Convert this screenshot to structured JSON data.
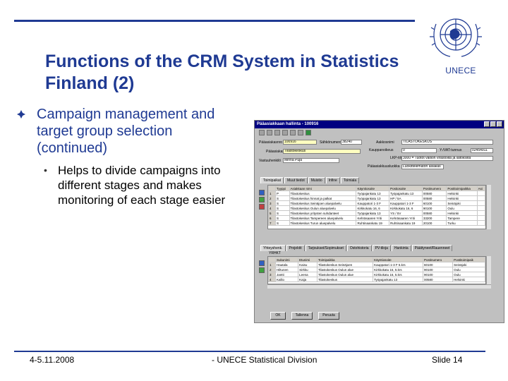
{
  "slide": {
    "title": "Functions of the CRM System in Statistics Finland (2)",
    "logo_text": "UNECE",
    "bullet_1": "Campaign management and target group selection (continued)",
    "bullet_2": "Helps to divide campaigns into different stages and makes monitoring of each stage easier",
    "sub_bullet_glyph": "•",
    "footer_date": "4-5.11.2008",
    "footer_center": "- UNECE Statistical Division",
    "footer_slide": "Slide 14",
    "accent_color": "#1f3a93"
  },
  "window": {
    "title": "Pääasiakkaan hallinta - 100916",
    "form": {
      "asiakasnro_label": "Pääasiakasnro",
      "asiakasnro_value": "100916",
      "sahkonro_label": "Sähkönumero",
      "sahkonro_value": "38240",
      "asiakkaan_label": "Pääasiakas",
      "asiakkaan_value": "Tilastokeskus",
      "yhteys_label": "Vastuuhenkilö",
      "yhteys_value": "Minna Puja",
      "aakkosnimi_label": "Aakkosnimi",
      "aakkosnimi_value": "TILASTOKESKUS",
      "kauppa_label": "Kauppanoikeus",
      "kauppa_value": "0",
      "ytunnus_label": "Y-/VAT-tunnus",
      "ytunnus_value": "02454911",
      "lkp_label": "LKP-tili",
      "lkp_value": "3000 = Tuotot valtion virastoilta ja laitoksilta",
      "luokka_label": "Pääasiakkuusluokka",
      "luokka_value": "Luokittelematon asiakas"
    },
    "tabs_top": [
      "Toimipaikat",
      "Muut tiedot",
      "Muistio",
      "Infine",
      "Toimiala"
    ],
    "upper_grid": {
      "headers": [
        "",
        "Tyyppi",
        "Asiakkaan nimi",
        "Käyntiosoite",
        "Postiosoite",
        "Postinumero",
        "Postitoimipaikka",
        "Asi"
      ],
      "rows": [
        [
          "1",
          "P",
          "Tilastokeskus",
          "Työpajankatu 13",
          "Työpajankatu 13",
          "00580",
          "Helsinki",
          ""
        ],
        [
          "2",
          "S",
          "Tilastokeskus hinnat ja palkat",
          "Työpajankatu 13",
          "HP / 5A",
          "00580",
          "Helsinki",
          ""
        ],
        [
          "3",
          "S",
          "Tilastokeskus Seinäjoen aluepalvelu",
          "Kauppatori 1-3 F",
          "Kauppatori 1-3 F",
          "60100",
          "Seinäjoki",
          ""
        ],
        [
          "4",
          "S",
          "Tilastokeskus Oulun aluepalvelu",
          "Kirkkokatu 16, 6",
          "Kirkkokatu 16, 6",
          "90100",
          "Oulu",
          ""
        ],
        [
          "5",
          "S",
          "Tilastokeskus yritysten suhdanteet",
          "Työpajankatu 13",
          "YS / 5V",
          "00580",
          "Helsinki",
          ""
        ],
        [
          "6",
          "S",
          "Tilastokeskus Tampereen aluepalvelu",
          "Kehräsaaren Yriti",
          "Kehräsaaren Yriti",
          "33200",
          "Tampere",
          ""
        ],
        [
          "7",
          "S",
          "Tilastokeskus Turun aluepalvelu",
          "Ruhtinaankatu 19",
          "Ruhtinaankatu 19",
          "20100",
          "Turku",
          ""
        ]
      ]
    },
    "tabs_bottom": [
      "Yhteyshenk.",
      "Projektit",
      "Tarjoukset/Sopimukset",
      "Ostohistoria",
      "PV-tiloja",
      "Hankinta",
      "Päättyneet/Rauenneet"
    ],
    "lower_label": "YRHKT",
    "lower_grid": {
      "headers": [
        "",
        "Sukunimi",
        "Etunimi",
        "Toimipaikka",
        "Käyntiosoite",
        "Postinumero",
        "Postitoimipaik"
      ],
      "rows": [
        [
          "1",
          "Hautala",
          "Kaisu",
          "Tilastokeskus Seinäjoen",
          "Kauppatori 1-3 F 5.krs",
          "60100",
          "Seinäjoki"
        ],
        [
          "2",
          "Hiltunen",
          "Sirkku",
          "Tilastokeskus Oulun alue",
          "Kirkkokatu 16, 5.krs",
          "90100",
          "Oulu"
        ],
        [
          "3",
          "Jantti",
          "Leena",
          "Tilastokeskus Oulun alue",
          "Kirkkokatu 16, 5.krs",
          "90100",
          "Oulu"
        ],
        [
          "4",
          "Kallio",
          "Kaija",
          "Tilastokeskus",
          "Työpajankatu 13",
          "00580",
          "Helsinki"
        ]
      ]
    },
    "buttons": {
      "ok": "OK",
      "save": "Tallenna",
      "cancel": "Peruuta"
    }
  }
}
